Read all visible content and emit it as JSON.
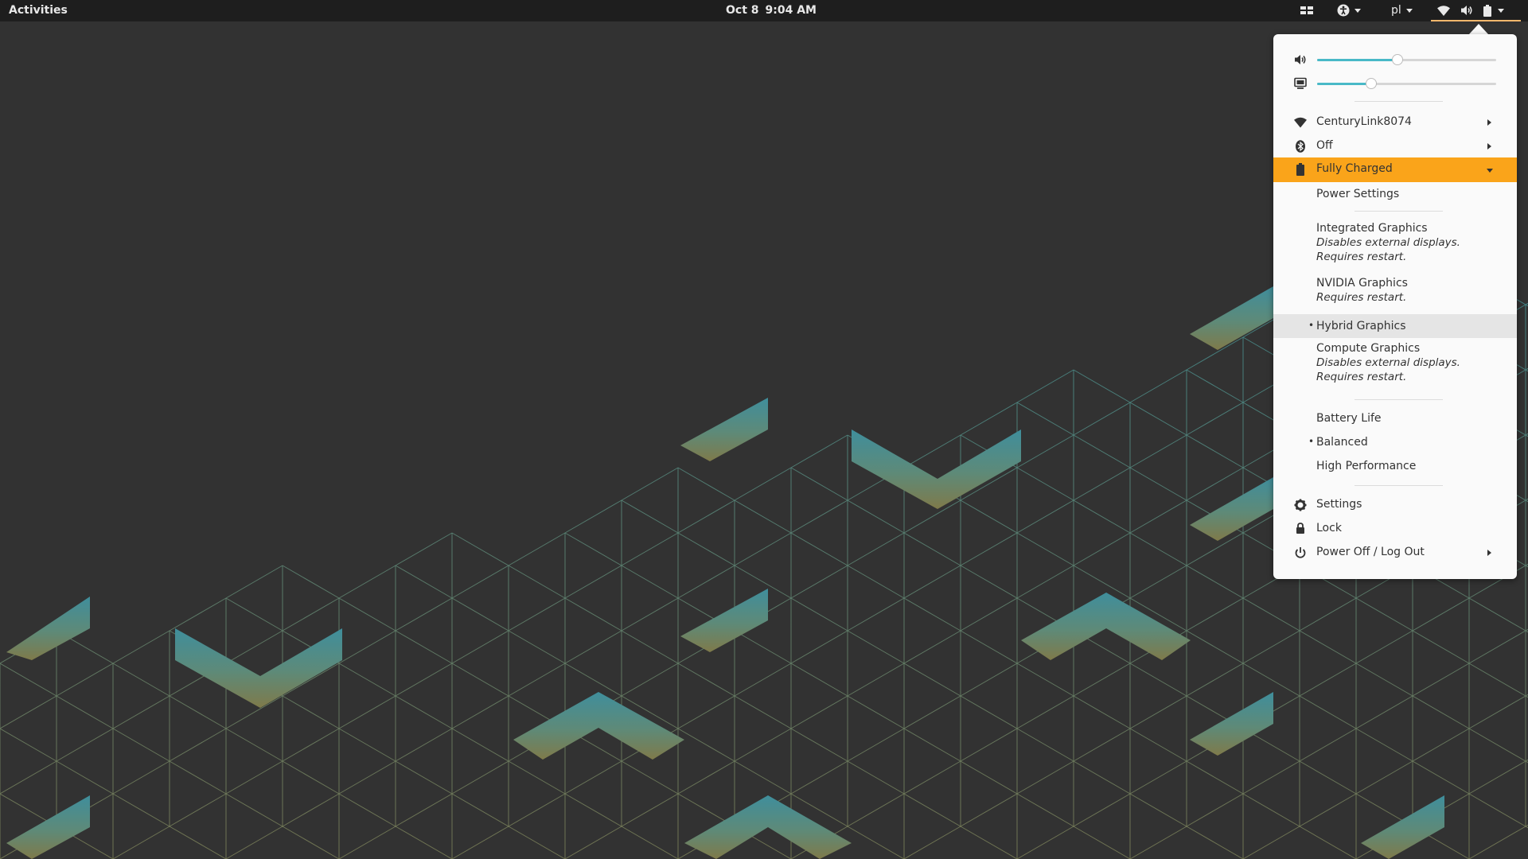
{
  "topbar": {
    "activities": "Activities",
    "date": "Oct 8",
    "time": "9:04 AM",
    "language": "pl"
  },
  "menu": {
    "volume_level": 0.45,
    "brightness_level": 0.3,
    "wifi_label": "CenturyLink8074",
    "bluetooth_label": "Off",
    "battery_label": "Fully Charged",
    "power_settings": "Power Settings",
    "graphics": [
      {
        "label": "Integrated Graphics",
        "sub": [
          "Disables external displays.",
          "Requires restart."
        ]
      },
      {
        "label": "NVIDIA Graphics",
        "sub": [
          "Requires restart."
        ]
      },
      {
        "label": "Hybrid Graphics",
        "sub": []
      },
      {
        "label": "Compute Graphics",
        "sub": [
          "Disables external displays.",
          "Requires restart."
        ]
      }
    ],
    "power_profiles": [
      "Battery Life",
      "Balanced",
      "High Performance"
    ],
    "settings": "Settings",
    "lock": "Lock",
    "power_off": "Power Off / Log Out"
  },
  "colors": {
    "accent": "#48b9c7",
    "highlight": "#faa41a",
    "menu_bg": "#fafafa",
    "topbar_bg": "#1e1e1e",
    "desktop_bg": "#323232"
  }
}
